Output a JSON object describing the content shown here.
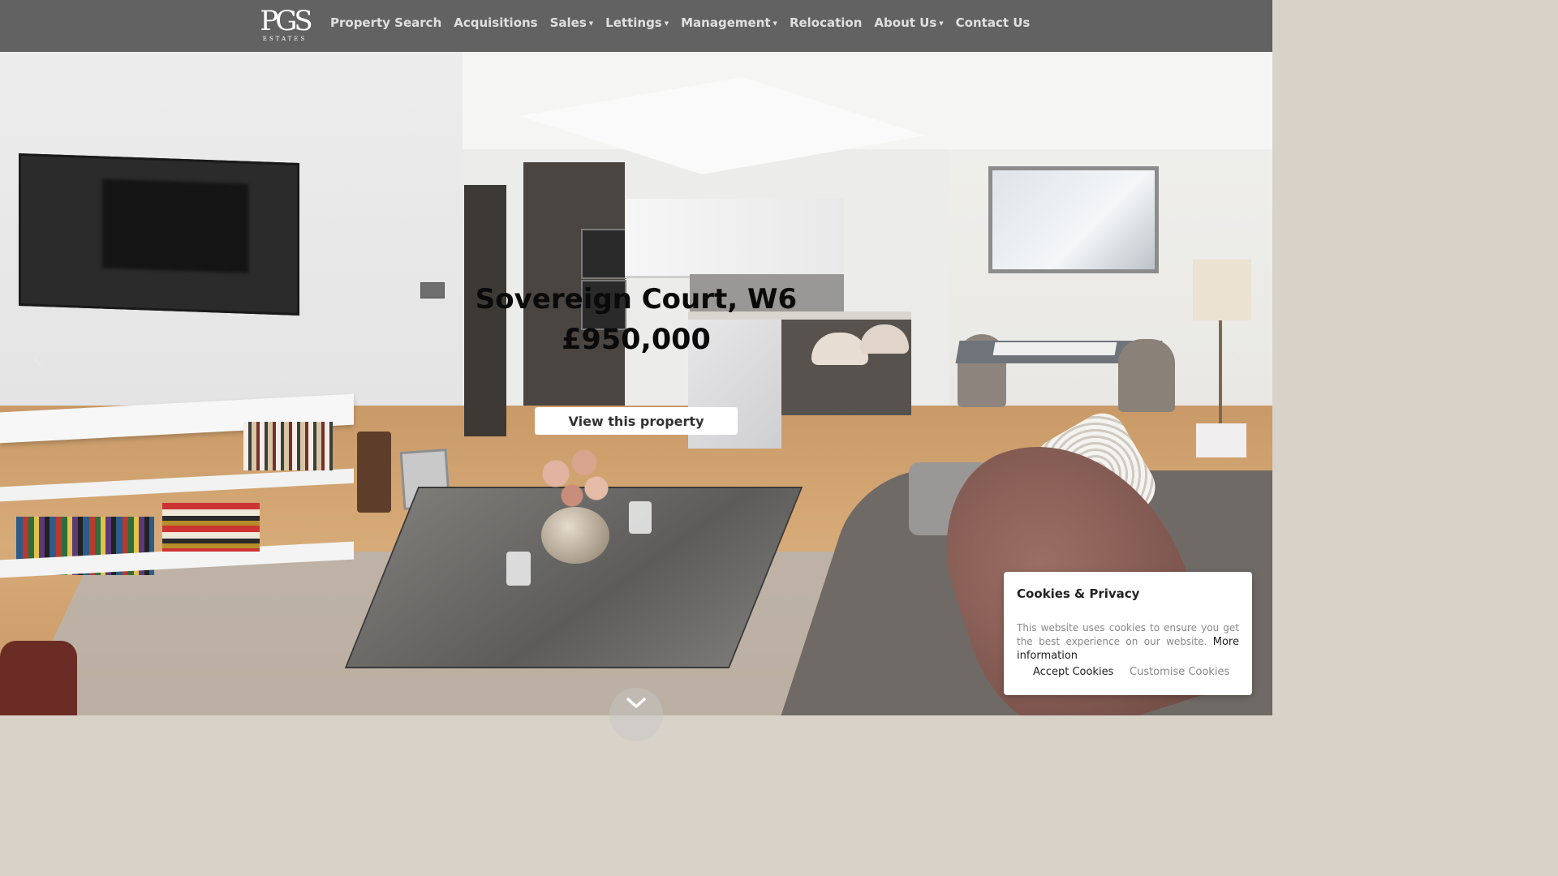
{
  "brand": {
    "logo_mark": "PGS",
    "logo_sub": "ESTATES"
  },
  "nav": {
    "items": [
      {
        "label": "Property Search",
        "has_dropdown": false
      },
      {
        "label": "Acquisitions",
        "has_dropdown": false
      },
      {
        "label": "Sales",
        "has_dropdown": true
      },
      {
        "label": "Lettings",
        "has_dropdown": true
      },
      {
        "label": "Management",
        "has_dropdown": true
      },
      {
        "label": "Relocation",
        "has_dropdown": false
      },
      {
        "label": "About Us",
        "has_dropdown": true
      },
      {
        "label": "Contact Us",
        "has_dropdown": false
      }
    ]
  },
  "hero": {
    "title": "Sovereign Court, W6",
    "price": "£950,000",
    "cta": "View this property",
    "prev_icon": "chevron-left-icon",
    "next_icon": "chevron-right-icon",
    "scroll_icon": "chevron-down-icon"
  },
  "cookies": {
    "title": "Cookies & Privacy",
    "text": "This website uses cookies to ensure you get the best experience on our website.",
    "more_link": "More information",
    "accept": "Accept Cookies",
    "customise": "Customise Cookies"
  },
  "colors": {
    "nav_bg": "#565656",
    "nav_text": "#e0e0e0",
    "cta_bg": "#ffffff"
  }
}
